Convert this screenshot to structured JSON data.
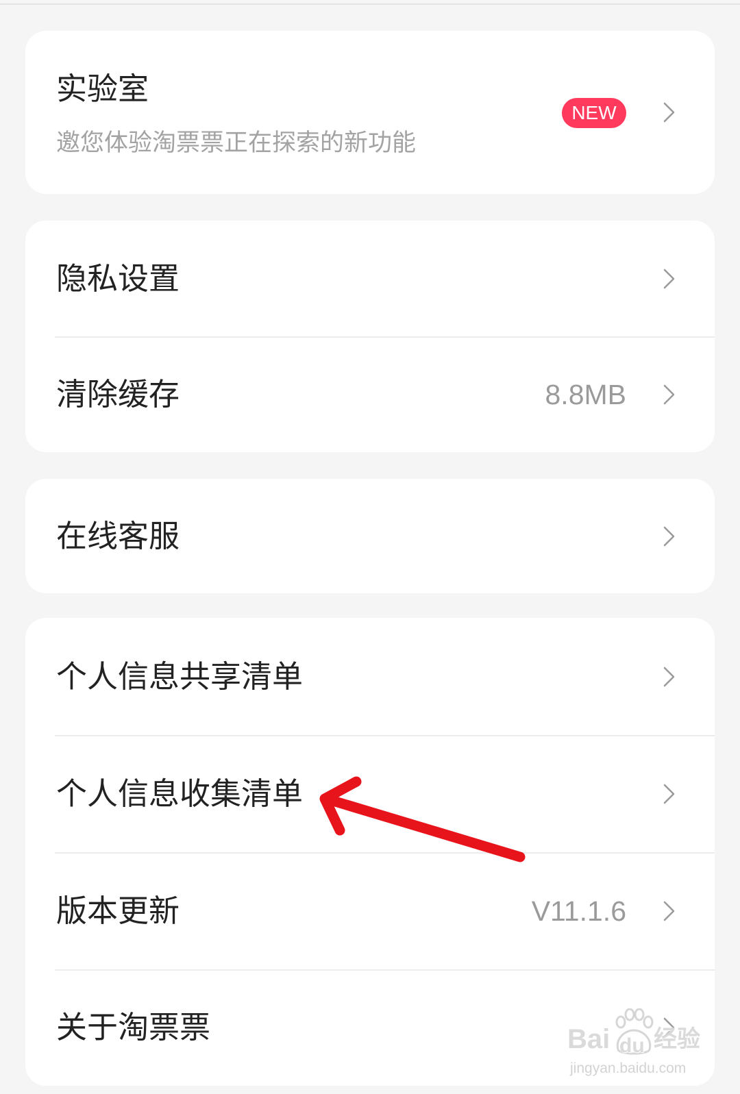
{
  "colors": {
    "page_bg": "#f5f5f6",
    "card_bg": "#ffffff",
    "badge_bg": "#ff3a5d",
    "primary_text": "#222222",
    "secondary_text": "#a3a3a3",
    "annotation_arrow": "#e8141b"
  },
  "icons": {
    "chevron": "chevron-right-icon",
    "annotation": "red-arrow-icon",
    "watermark": "baidu-paw-icon"
  },
  "lab": {
    "title": "实验室",
    "subtitle": "邀您体验淘票票正在探索的新功能",
    "badge": "NEW"
  },
  "settings": {
    "privacy": {
      "label": "隐私设置"
    },
    "clear_cache": {
      "label": "清除缓存",
      "value": "8.8MB"
    },
    "online_service": {
      "label": "在线客服"
    },
    "info_sharing": {
      "label": "个人信息共享清单"
    },
    "info_collection": {
      "label": "个人信息收集清单"
    },
    "version_update": {
      "label": "版本更新",
      "value": "V11.1.6"
    },
    "about": {
      "label": "关于淘票票"
    }
  },
  "watermark": {
    "brand_a": "Bai",
    "brand_b": "du",
    "brand_c": "经验",
    "url": "jingyan.baidu.com"
  }
}
